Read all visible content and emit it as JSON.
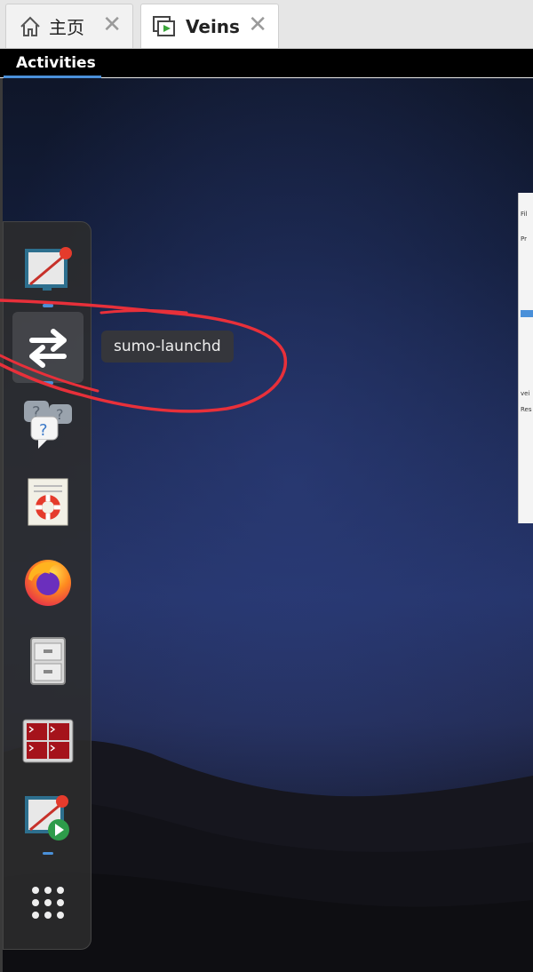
{
  "vm_tabs": [
    {
      "label": "主页",
      "icon": "home-icon"
    },
    {
      "label": "Veins",
      "icon": "vm-play-icon"
    }
  ],
  "topbar": {
    "activities_label": "Activities"
  },
  "dock": {
    "items": [
      {
        "name": "omnet-ide",
        "icon": "omnet-ide-icon",
        "running": true
      },
      {
        "name": "sumo-launchd",
        "icon": "exchange-arrows-icon",
        "running": true,
        "hovered": true
      },
      {
        "name": "help",
        "icon": "help-bubbles-icon"
      },
      {
        "name": "help-lifebuoy",
        "icon": "lifebuoy-document-icon"
      },
      {
        "name": "firefox",
        "icon": "firefox-icon"
      },
      {
        "name": "files",
        "icon": "file-cabinet-icon"
      },
      {
        "name": "terminal",
        "icon": "terminal-grid-icon"
      },
      {
        "name": "omnet-run",
        "icon": "omnet-run-icon",
        "running": true
      },
      {
        "name": "show-applications",
        "icon": "app-grid-icon"
      }
    ]
  },
  "tooltip": {
    "text": "sumo-launchd"
  },
  "colors": {
    "accent": "#4a90d9",
    "annotation": "#e8303a",
    "topbar": "#000000"
  }
}
